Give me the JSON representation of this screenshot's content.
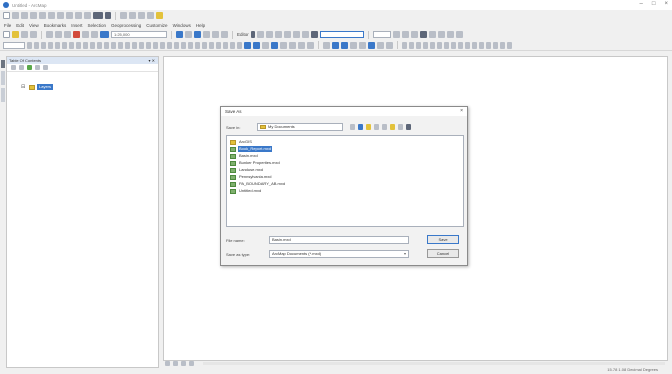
{
  "window": {
    "title": "Untitled - ArcMap"
  },
  "menubar": {
    "items": [
      "File",
      "Edit",
      "View",
      "Bookmarks",
      "Insert",
      "Selection",
      "Geoprocessing",
      "Customize",
      "Windows",
      "Help"
    ]
  },
  "toolbar": {
    "scale_value": "1:25,000",
    "editor_label": "Editor"
  },
  "toc": {
    "title": "Table Of Contents",
    "layer_label": "Layers"
  },
  "dialog": {
    "title": "Save As",
    "look_in_label": "Save in:",
    "look_in_value": "My Documents",
    "files": [
      "ArcGIS",
      "Book_Report.mxd",
      "Basin.mxd",
      "Bunker Properties.mxd",
      "Landuse.mxd",
      "Pennsylvania.mxd",
      "PA_BOUNDARY_AB.mxd",
      "Untitled.mxd"
    ],
    "selected_index": 1,
    "file_name_label": "File name:",
    "file_name_value": "Basin.mxd",
    "save_type_label": "Save as type:",
    "save_type_value": "ArcMap Documents (*.mxd)",
    "save_button": "Save",
    "cancel_button": "Cancel"
  },
  "status": {
    "coordinates": "15.78  1.08 Decimal Degrees"
  }
}
